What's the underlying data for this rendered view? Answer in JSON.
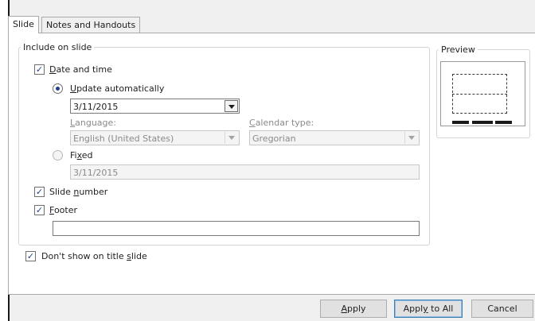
{
  "tabs": [
    {
      "label": "Slide",
      "active": true
    },
    {
      "label": "Notes and Handouts",
      "active": false
    }
  ],
  "include_group": {
    "legend": "Include on slide",
    "date_time": {
      "checked": true,
      "label_pre": "",
      "label_key": "D",
      "label_post": "ate and time",
      "update_auto": {
        "selected": true,
        "label_key": "U",
        "label_post": "pdate automatically",
        "date_value": "3/11/2015"
      },
      "language": {
        "label_key": "L",
        "label_post": "anguage:",
        "value": "English (United States)"
      },
      "calendar": {
        "label_key": "C",
        "label_post": "alendar type:",
        "value": "Gregorian"
      },
      "fixed": {
        "selected": false,
        "label_pre": "Fi",
        "label_key": "x",
        "label_post": "ed",
        "value": "3/11/2015"
      }
    },
    "slide_number": {
      "checked": true,
      "label_pre": "Slide ",
      "label_key": "n",
      "label_post": "umber"
    },
    "footer": {
      "checked": true,
      "label_key": "F",
      "label_post": "ooter",
      "value": ""
    }
  },
  "dont_show": {
    "checked": true,
    "label_pre": "Don't show on title ",
    "label_key": "s",
    "label_post": "lide"
  },
  "preview": {
    "legend": "Preview"
  },
  "buttons": {
    "apply": {
      "pre": "",
      "key": "A",
      "post": "pply"
    },
    "apply_all": {
      "pre": "Appl",
      "key": "y",
      "post": " to All"
    },
    "cancel": "Cancel"
  },
  "icons": {
    "check": "checkmark-icon",
    "dropdown": "chevron-down-icon"
  },
  "colors": {
    "accent": "#1f3f8e",
    "default_button_border": "#3c7fb1"
  }
}
